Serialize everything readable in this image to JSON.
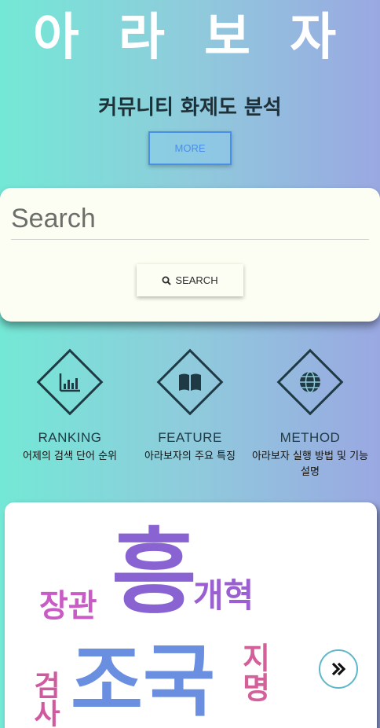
{
  "header": {
    "title": "아 라 보 자",
    "subtitle": "커뮤니티 화제도 분석",
    "more_label": "MORE"
  },
  "search": {
    "placeholder": "Search",
    "button_label": "SEARCH"
  },
  "features": [
    {
      "icon": "bar-chart-icon",
      "title": "RANKING",
      "desc": "어제의 검색 단어 순위"
    },
    {
      "icon": "book-icon",
      "title": "FEATURE",
      "desc": "아라보자의 주요 특징"
    },
    {
      "icon": "globe-icon",
      "title": "METHOD",
      "desc": "아라보자 실행 방법 및 기능 설명"
    }
  ],
  "word_cloud": {
    "words": [
      {
        "text": "흥",
        "color": "#8a63d2"
      },
      {
        "text": "장관",
        "color": "#c95bc5"
      },
      {
        "text": "개혁",
        "color": "#9a5fd0"
      },
      {
        "text": "조국",
        "color": "#6a8fe0"
      },
      {
        "text": "지명",
        "color": "#d4609a"
      },
      {
        "text": "검사",
        "color": "#d05aa0"
      }
    ]
  },
  "colors": {
    "accent": "#4a8fe6",
    "dark": "#1f3a44",
    "card": "#fdfef3"
  }
}
